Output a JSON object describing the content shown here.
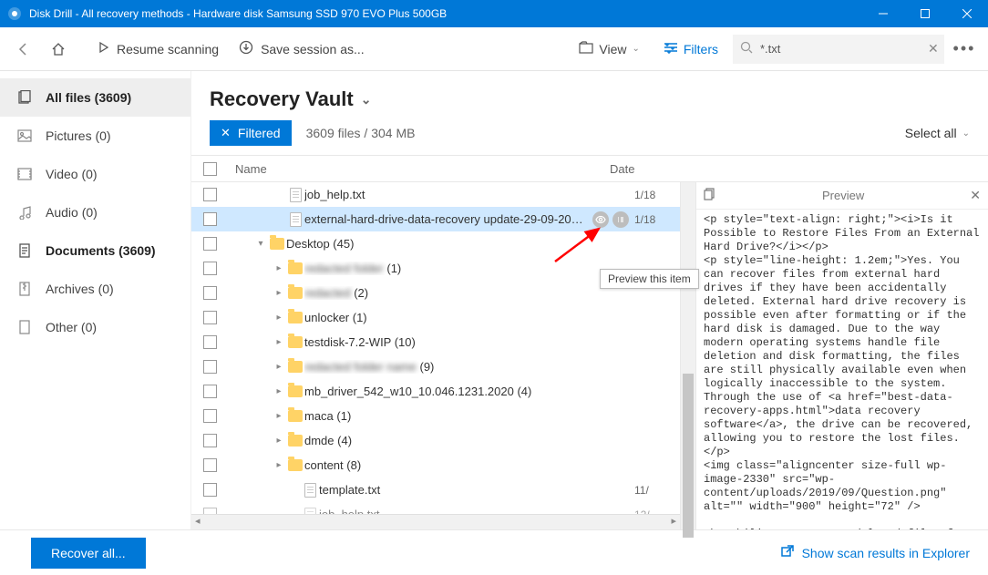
{
  "window": {
    "title": "Disk Drill - All recovery methods - Hardware disk Samsung SSD 970 EVO Plus 500GB"
  },
  "toolbar": {
    "resume": "Resume scanning",
    "save": "Save session as...",
    "view": "View",
    "filters": "Filters",
    "search_value": "*.txt"
  },
  "sidebar": {
    "all_files": "All files (3609)",
    "pictures": "Pictures (0)",
    "video": "Video (0)",
    "audio": "Audio (0)",
    "documents": "Documents (3609)",
    "archives": "Archives (0)",
    "other": "Other (0)"
  },
  "content": {
    "title": "Recovery Vault",
    "filtered": "Filtered",
    "count": "3609 files / 304 MB",
    "select_all": "Select all",
    "col_name": "Name",
    "col_date": "Date",
    "tooltip": "Preview this item",
    "preview_title": "Preview"
  },
  "rows": {
    "r0": {
      "name": "job_help.txt",
      "date": "1/18"
    },
    "r1": {
      "name": "external-hard-drive-data-recovery update-29-09-202...",
      "date": "1/18"
    },
    "r2": {
      "name": "Desktop (45)"
    },
    "r3": {
      "name": "redacted folder",
      "count": "(1)"
    },
    "r4": {
      "name": "redacted",
      "count": "(2)"
    },
    "r5": {
      "name": "unlocker (1)"
    },
    "r6": {
      "name": "testdisk-7.2-WIP (10)"
    },
    "r7": {
      "name": "redacted folder name",
      "count": "(9)"
    },
    "r8": {
      "name": "mb_driver_542_w10_10.046.1231.2020 (4)"
    },
    "r9": {
      "name": "maca (1)"
    },
    "r10": {
      "name": "dmde (4)"
    },
    "r11": {
      "name": "content (8)"
    },
    "r12": {
      "name": "template.txt",
      "date": "11/"
    },
    "r13": {
      "name": "job_help.txt",
      "date": "12/"
    }
  },
  "preview_text": "<p style=\"text-align: right;\"><i>Is it Possible to Restore Files From an External Hard Drive?</i></p>\n<p style=\"line-height: 1.2em;\">Yes. You can recover files from external hard drives if they have been accidentally deleted. External hard drive recovery is possible even after formatting or if the hard disk is damaged. Due to the way modern operating systems handle file deletion and disk formatting, the files are still physically available even when logically inaccessible to the system. Through the use of <a href=\"best-data-recovery-apps.html\">data recovery software</a>, the drive can be recovered, allowing you to restore the lost files.</p>\n<img class=\"aligncenter size-full wp-image-2330\" src=\"wp-content/uploads/2019/09/Question.png\" alt=\"\" width=\"900\" height=\"72\" />\n\nThe ability to recover deleted files from an external hard drive can be extremely important in a variety of situations. Many computer users use an external HDD as the media on which to store their system's backups. Loss of",
  "footer": {
    "recover": "Recover all...",
    "explorer": "Show scan results in Explorer"
  }
}
